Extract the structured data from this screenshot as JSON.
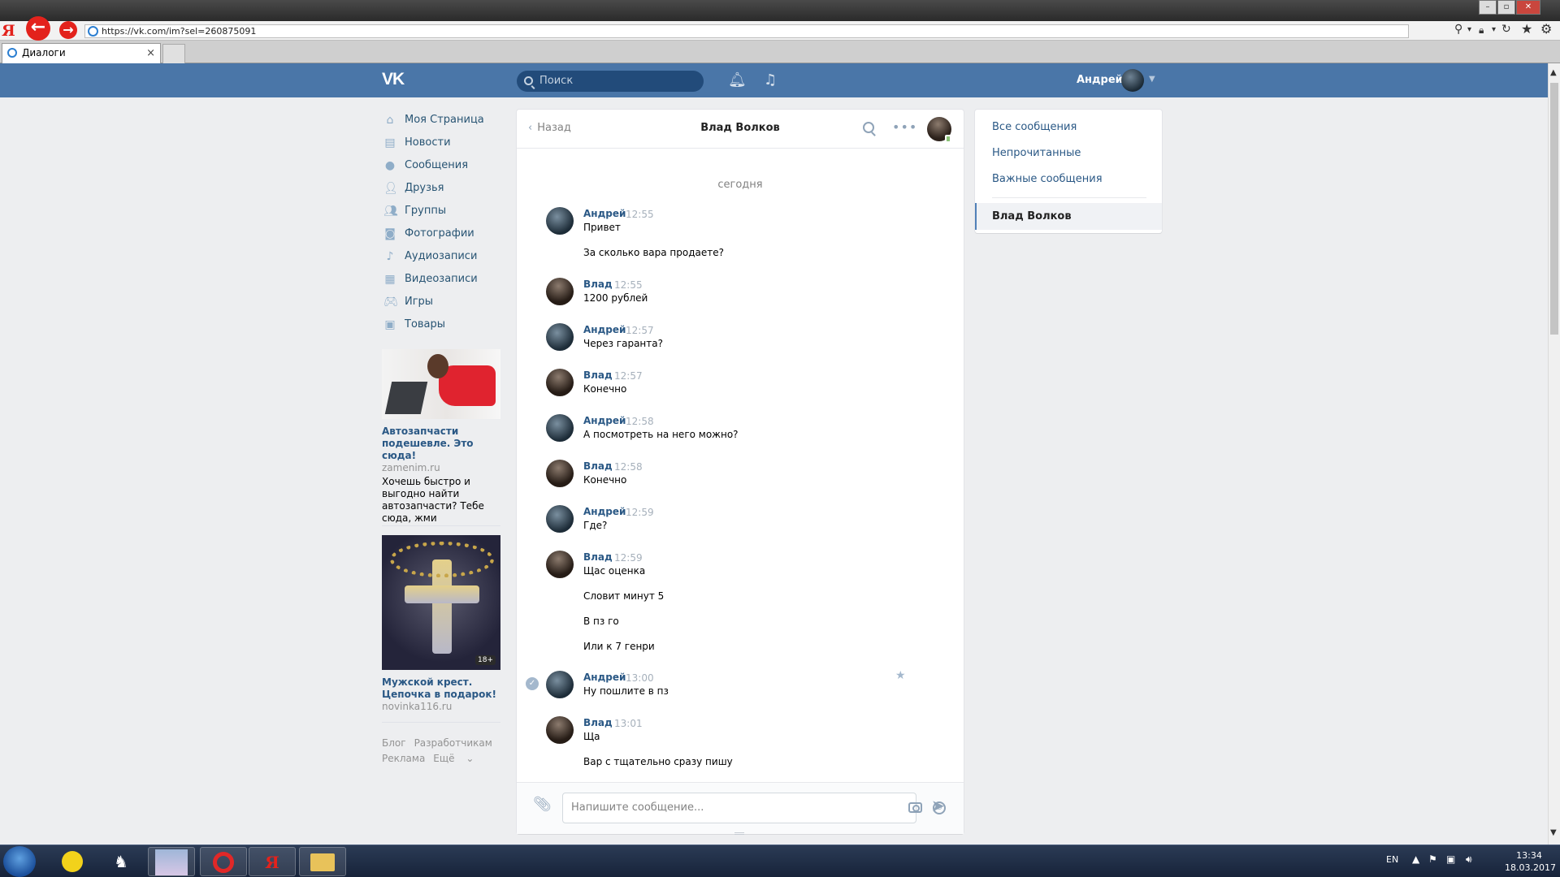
{
  "browser": {
    "url": "https://vk.com/im?sel=260875091",
    "tab_title": "Диалоги",
    "tab_close": "×"
  },
  "header": {
    "logo": "VK",
    "search_placeholder": "Поиск",
    "user_name": "Андрей"
  },
  "menu": [
    {
      "label": "Моя Страница",
      "icon": "home-icon"
    },
    {
      "label": "Новости",
      "icon": "news-icon"
    },
    {
      "label": "Сообщения",
      "icon": "messages-icon"
    },
    {
      "label": "Друзья",
      "icon": "friends-icon"
    },
    {
      "label": "Группы",
      "icon": "groups-icon"
    },
    {
      "label": "Фотографии",
      "icon": "camera-icon"
    },
    {
      "label": "Аудиозаписи",
      "icon": "music-icon"
    },
    {
      "label": "Видеозаписи",
      "icon": "video-icon"
    },
    {
      "label": "Игры",
      "icon": "gamepad-icon"
    },
    {
      "label": "Товары",
      "icon": "bag-icon"
    }
  ],
  "ads": [
    {
      "title": "Автозапчасти подешевле. Это сюда!",
      "domain": "zamenim.ru",
      "text": "Хочешь быстро и выгодно найти автозапчасти? Тебе сюда, жми"
    },
    {
      "title": "Мужской крест. Цепочка в подарок!",
      "domain": "novinka116.ru",
      "badge": "18+"
    }
  ],
  "footer": {
    "blog": "Блог",
    "developers": "Разработчикам",
    "ads": "Реклама",
    "more": "Ещё"
  },
  "dialog": {
    "back": "Назад",
    "title": "Влад Волков",
    "day": "сегодня",
    "input_placeholder": "Напишите сообщение...",
    "messages": [
      {
        "author": "Андрей",
        "time": "12:55",
        "lines": [
          "Привет",
          "За сколько вара продаете?"
        ]
      },
      {
        "author": "Влад",
        "time": "12:55",
        "lines": [
          "1200 рублей"
        ]
      },
      {
        "author": "Андрей",
        "time": "12:57",
        "lines": [
          "Через гаранта?"
        ]
      },
      {
        "author": "Влад",
        "time": "12:57",
        "lines": [
          "Конечно"
        ]
      },
      {
        "author": "Андрей",
        "time": "12:58",
        "lines": [
          "А посмотреть на него можно?"
        ]
      },
      {
        "author": "Влад",
        "time": "12:58",
        "lines": [
          "Конечно"
        ]
      },
      {
        "author": "Андрей",
        "time": "12:59",
        "lines": [
          "Где?"
        ]
      },
      {
        "author": "Влад",
        "time": "12:59",
        "lines": [
          "Щас оценка",
          "Словит минут 5",
          "В пз го",
          "Или к 7 генри"
        ]
      },
      {
        "author": "Андрей",
        "time": "13:00",
        "lines": [
          "Ну пошлите в пз"
        ]
      },
      {
        "author": "Влад",
        "time": "13:01",
        "lines": [
          "Ща",
          "Вар с тщательно сразу пишу"
        ]
      }
    ]
  },
  "filters": {
    "all": "Все сообщения",
    "unread": "Непрочитанные",
    "important": "Важные сообщения",
    "active_chat": "Влад Волков"
  },
  "taskbar": {
    "lang": "EN",
    "time": "13:34",
    "date": "18.03.2017"
  },
  "colors": {
    "vk_blue": "#4a76a8",
    "link": "#2a5885",
    "page_bg": "#edeef0"
  }
}
